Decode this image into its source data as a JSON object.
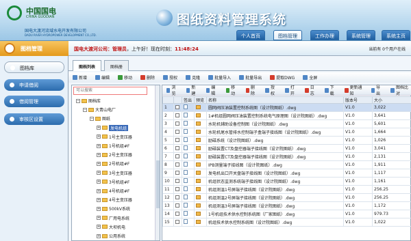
{
  "header": {
    "logo_cn": "中国国电",
    "logo_en": "CHINA GUODIAN",
    "company": "国电大渡河流域水电开发有限公司",
    "company_en": "DADU RIVER HYDROPOWER DEVELOPMENT CO.,LTD.",
    "title": "图纸资料管理系统",
    "tabs": [
      "个人首页",
      "图档管理",
      "工作办理",
      "系统管理",
      "系统主页"
    ]
  },
  "module": {
    "label": "图档管理"
  },
  "infobar": {
    "company": "国电大渡河公司：",
    "role": "管理员",
    "greeting": "，上午好！",
    "time_label": "现在时刻：",
    "time": "11:48:24",
    "online": "当前有 0个用户在线"
  },
  "sidebar": {
    "items": [
      "图档库",
      "申请借阅",
      "借阅管理",
      "审核区设置"
    ]
  },
  "main": {
    "tabs": [
      "图档列表",
      "图档册"
    ],
    "toolbar": [
      "新增",
      "编辑",
      "移动",
      "删除",
      "授权",
      "克隆",
      "批量导入",
      "批量导出",
      "提取DWG",
      "全屏"
    ],
    "toolbar2": [
      "浏览",
      "新建",
      "编辑",
      "移动",
      "删除",
      "授权",
      "打开",
      "日志",
      "下载",
      "更新通知",
      "导出",
      "图档比对"
    ]
  },
  "tree": {
    "search_placeholder": "可以搜索",
    "nodes": [
      {
        "label": "图档库",
        "level": 0
      },
      {
        "label": "大青山电厂",
        "level": 1
      },
      {
        "label": "图纸",
        "level": 2
      },
      {
        "label": "发电机组",
        "level": 3
      },
      {
        "label": "1号主变压器",
        "level": 3
      },
      {
        "label": "1号机组#F",
        "level": 3
      },
      {
        "label": "2号主变压器",
        "level": 3
      },
      {
        "label": "2号机组#F",
        "level": 3
      },
      {
        "label": "3号主变压器",
        "level": 3
      },
      {
        "label": "3号机组#F",
        "level": 3
      },
      {
        "label": "4号机组#F",
        "level": 3
      },
      {
        "label": "4号主变压器",
        "level": 3
      },
      {
        "label": "500kV系统",
        "level": 3
      },
      {
        "label": "厂用电系统",
        "level": 3
      },
      {
        "label": "大坝机电",
        "level": 3
      },
      {
        "label": "公用系统",
        "level": 3
      }
    ]
  },
  "grid": {
    "headers": [
      "",
      "",
      "签出",
      "预览",
      "名称",
      "版本号",
      "大小"
    ],
    "rows": [
      {
        "num": "1",
        "name": "圆网阀压油装置控制系统图（设计院图纸）.dwg",
        "ver": "V1.0",
        "size": "3,022"
      },
      {
        "num": "2",
        "name": "1#机组圆网阀压油装置控制系统电气原理图（设计院图纸）.dwg",
        "ver": "V1.0",
        "size": "3,641"
      },
      {
        "num": "3",
        "name": "水轮机辅助设备控制图（设计院图纸）.dwg",
        "ver": "V1.0",
        "size": "5,601"
      },
      {
        "num": "4",
        "name": "水轮机尾水管排水控制端子盒端子接线图（设计院图纸）.dwg",
        "ver": "V1.0",
        "size": "1,664"
      },
      {
        "num": "5",
        "name": "励磁系统（设计院图纸）.dwg",
        "ver": "V1.0",
        "size": "1,026"
      },
      {
        "num": "6",
        "name": "励磁装置CT及盘控器端子接线图（设计院图纸）.dwg",
        "ver": "V1.0",
        "size": "3,041"
      },
      {
        "num": "7",
        "name": "励磁装置CT及盘控器端子接线图（设计院图纸）.dwg",
        "ver": "V1.0",
        "size": "2,131"
      },
      {
        "num": "8",
        "name": "IPB测量端子接线图（设计院图纸）.dwg",
        "ver": "V1.0",
        "size": "1,911"
      },
      {
        "num": "9",
        "name": "发电机出口开关盘端子接线图（设计院图纸）.dwg",
        "ver": "V1.0",
        "size": "1,117"
      },
      {
        "num": "10",
        "name": "机组状态监测系统端子接线图（设计院图纸）.dwg",
        "ver": "V1.0",
        "size": "1,161"
      },
      {
        "num": "11",
        "name": "机组测温1号屏端子接线图（设计院图纸）.dwg",
        "ver": "V1.0",
        "size": "256.25"
      },
      {
        "num": "12",
        "name": "机组测温2号屏端子接线图（设计院图纸）.dwg",
        "ver": "V1.0",
        "size": "256.25"
      },
      {
        "num": "13",
        "name": "机组测温3号屏端子接线图（设计院图纸）.dwg",
        "ver": "V1.0",
        "size": "1,172"
      },
      {
        "num": "14",
        "name": "1号机组技术供水控制系统图（厂家图纸）.dwg",
        "ver": "V1.0",
        "size": "979.73"
      },
      {
        "num": "15",
        "name": "机组技术供水控制系统图（设计院图纸）.dwg",
        "ver": "V1.0",
        "size": "1,022"
      }
    ]
  }
}
